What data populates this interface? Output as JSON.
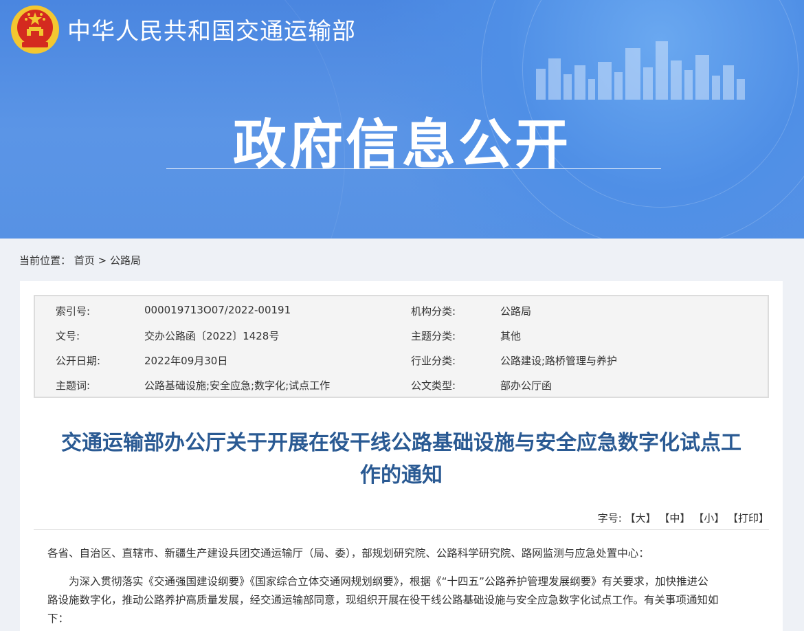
{
  "header": {
    "ministry_name": "中华人民共和国交通运输部",
    "section_title": "政府信息公开"
  },
  "breadcrumb": {
    "label": "当前位置：",
    "home": "首页",
    "separator": ">",
    "current": "公路局"
  },
  "meta": {
    "index_label": "索引号:",
    "index_value": "000019713O07/2022-00191",
    "org_label": "机构分类:",
    "org_value": "公路局",
    "docno_label": "文号:",
    "docno_value": "交办公路函〔2022〕1428号",
    "topic_label": "主题分类:",
    "topic_value": "其他",
    "date_label": "公开日期:",
    "date_value": "2022年09月30日",
    "industry_label": "行业分类:",
    "industry_value": "公路建设;路桥管理与养护",
    "keywords_label": "主题词:",
    "keywords_value": "公路基础设施;安全应急;数字化;试点工作",
    "doctype_label": "公文类型:",
    "doctype_value": "部办公厅函"
  },
  "document": {
    "title_line1": "交通运输部办公厅关于开展在役干线公路基础设施与安全应急数字化试点工",
    "title_line2": "作的通知",
    "fontsize_label": "字号:",
    "fontsize_large": "【大】",
    "fontsize_medium": "【中】",
    "fontsize_small": "【小】",
    "print": "【打印】",
    "recipients": "各省、自治区、直辖市、新疆生产建设兵团交通运输厅（局、委），部规划研究院、公路科学研究院、路网监测与应急处置中心：",
    "para1_line1": "为深入贯彻落实《交通强国建设纲要》《国家综合立体交通网规划纲要》，根据《“十四五”公路养护管理发展纲要》有关要求，加快推进公",
    "para1_line2": "路设施数字化，推动公路养护高质量发展，经交通运输部同意，现组织开展在役干线公路基础设施与安全应急数字化试点工作。有关事项通知如",
    "para1_line3": "下："
  },
  "colors": {
    "banner": "#4f8fe6",
    "title": "#2a5a93",
    "emblem_red": "#d42a1f",
    "emblem_gold": "#f3c730"
  }
}
